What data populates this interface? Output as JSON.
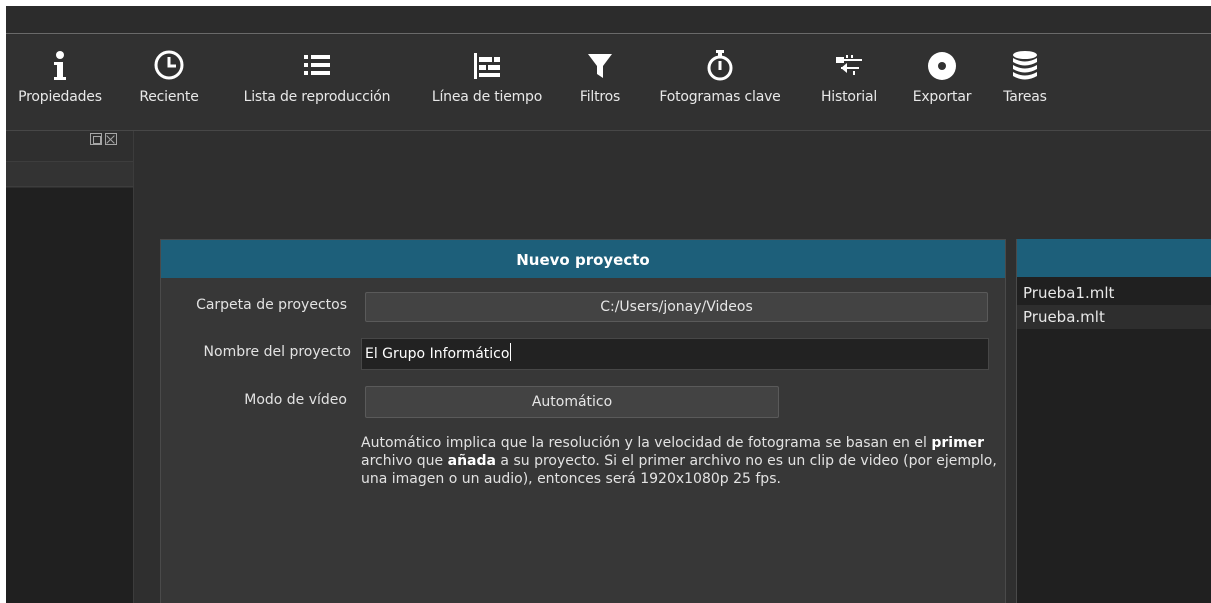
{
  "toolbar": {
    "items": [
      {
        "label": "Propiedades",
        "icon": "info-icon"
      },
      {
        "label": "Reciente",
        "icon": "clock-icon"
      },
      {
        "label": "Lista de reproducción",
        "icon": "list-icon"
      },
      {
        "label": "Línea de tiempo",
        "icon": "timeline-icon"
      },
      {
        "label": "Filtros",
        "icon": "filter-icon"
      },
      {
        "label": "Fotogramas clave",
        "icon": "stopwatch-icon"
      },
      {
        "label": "Historial",
        "icon": "history-icon"
      },
      {
        "label": "Exportar",
        "icon": "disc-icon"
      },
      {
        "label": "Tareas",
        "icon": "database-icon"
      }
    ]
  },
  "new_project": {
    "title": "Nuevo proyecto",
    "folder_label": "Carpeta de proyectos",
    "folder_value": "C:/Users/jonay/Videos",
    "name_label": "Nombre del proyecto",
    "name_value": "El Grupo Informático",
    "mode_label": "Modo de vídeo",
    "mode_value": "Automático",
    "description_parts": [
      "Automático implica que la resolución y la velocidad de fotograma se basan en el ",
      "primer",
      " archivo que ",
      "añada",
      " a su proyecto. Si el primer archivo no es un clip de video (por ejemplo, una imagen o un audio), entonces será 1920x1080p 25 fps."
    ]
  },
  "recent_projects": {
    "items": [
      "Prueba1.mlt",
      "Prueba.mlt"
    ]
  },
  "colors": {
    "accent": "#1d5f7a",
    "background": "#2f2f2f"
  }
}
